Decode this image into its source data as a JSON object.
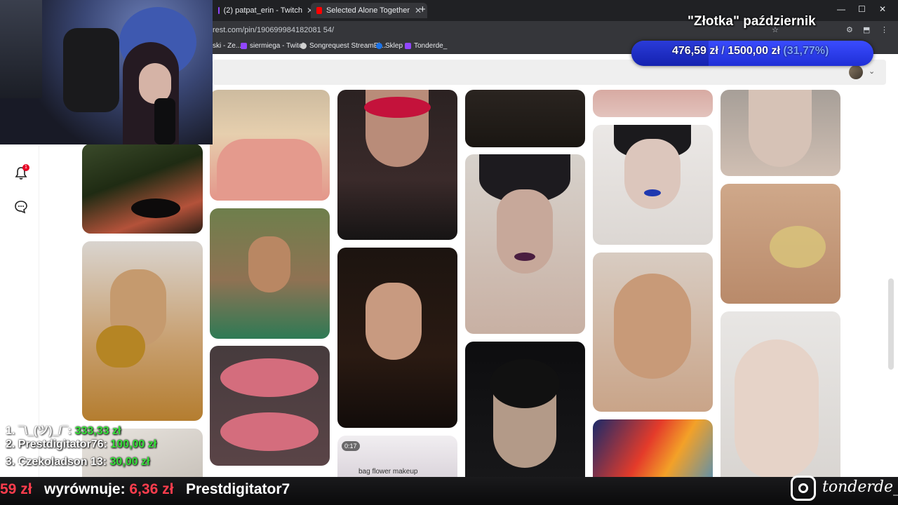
{
  "browser": {
    "tabs": [
      {
        "label": "(2) patpat_erin - Twitch",
        "favicon_color": "#9146ff"
      },
      {
        "label": "Selected Alone Together Mix - \\",
        "favicon_color": "#ff0000"
      }
    ],
    "new_tab_icon": "plus-icon",
    "address": "rest.com/pin/190699984182081 54/",
    "bookmarks": [
      {
        "label": "ski - Ze...",
        "icon_color": "#c9c9c9"
      },
      {
        "label": "siermiega - Twitch",
        "icon_color": "#9146ff"
      },
      {
        "label": "Songrequest StreamEl...",
        "icon_color": "#d0d0d0"
      },
      {
        "label": "Sklep",
        "icon_color": "#1b73e8"
      },
      {
        "label": "Tonderde_",
        "icon_color": "#9146ff"
      }
    ]
  },
  "sidebar": {
    "notification_count": "1"
  },
  "overlay": {
    "goal_title": "\"Złotka\" październik",
    "goal_current": "476,59 zł",
    "goal_sep": "/",
    "goal_target": "1500,00 zł",
    "goal_percent": "(31,77%)",
    "goal_fraction": 0.3177,
    "accent": "#2b3df0",
    "leaderboard": [
      {
        "rank_name": "1. ¯\\_(ツ)_/¯:",
        "amount": "333,33 zł"
      },
      {
        "rank_name": "2. Prestdigitator76:",
        "amount": "100,00 zł"
      },
      {
        "rank_name": "3. Czekoladson 13:",
        "amount": "30,00 zł"
      }
    ],
    "ticker": {
      "prev_amount": "59 zł",
      "label": "wyrównuje:",
      "amount": "6,36 zł",
      "next_name": "Prestdigitator7"
    },
    "instagram_handle": "tonderde_"
  },
  "pin_grid": {
    "video_badge": "0:17",
    "video_caption": "bag flower makeup"
  }
}
